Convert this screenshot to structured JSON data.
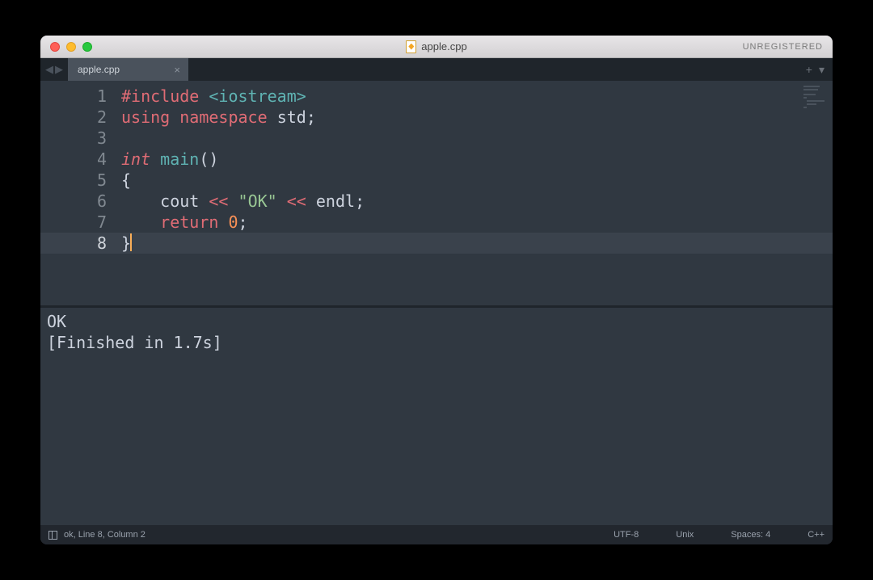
{
  "titlebar": {
    "filename": "apple.cpp",
    "unregistered": "UNREGISTERED"
  },
  "tabs": {
    "active": "apple.cpp"
  },
  "gutter": [
    "1",
    "2",
    "3",
    "4",
    "5",
    "6",
    "7",
    "8"
  ],
  "code": {
    "l1": {
      "a": "#include",
      "b": " ",
      "c": "<iostream>"
    },
    "l2": {
      "a": "using",
      "b": " ",
      "c": "namespace",
      "d": " ",
      "e": "std",
      "f": ";"
    },
    "l4": {
      "a": "int",
      "b": " ",
      "c": "main",
      "d": "()"
    },
    "l5": {
      "a": "{"
    },
    "l6": {
      "indent": "    ",
      "a": "cout",
      "b": " ",
      "c": "<<",
      "d": " ",
      "e": "\"OK\"",
      "f": " ",
      "g": "<<",
      "h": " ",
      "i": "endl",
      "j": ";"
    },
    "l7": {
      "indent": "    ",
      "a": "return",
      "b": " ",
      "c": "0",
      "d": ";"
    },
    "l8": {
      "a": "}"
    }
  },
  "output": {
    "line1": "OK",
    "line2": "[Finished in 1.7s]"
  },
  "status": {
    "left": "ok, Line 8, Column 2",
    "encoding": "UTF-8",
    "lineending": "Unix",
    "spaces": "Spaces: 4",
    "lang": "C++"
  }
}
